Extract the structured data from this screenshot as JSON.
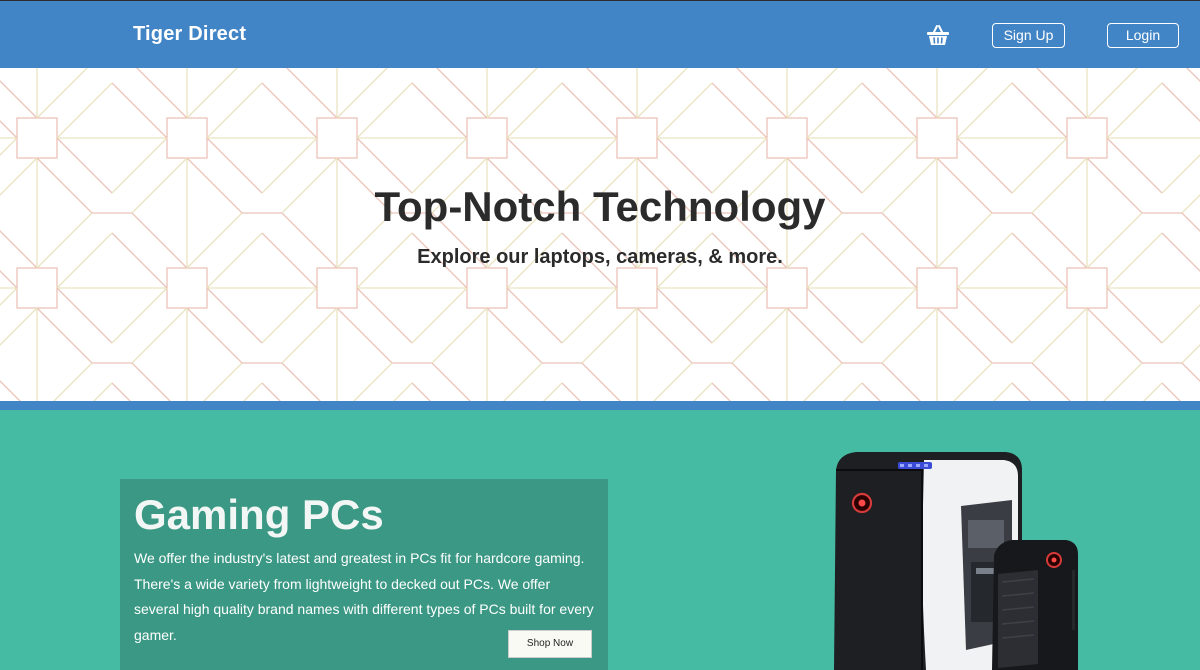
{
  "header": {
    "brand": "Tiger Direct",
    "cart_icon": "shopping-basket-icon",
    "signup_label": "Sign Up",
    "login_label": "Login"
  },
  "hero": {
    "title": "Top-Notch Technology",
    "subtitle": "Explore our laptops, cameras, & more."
  },
  "gaming": {
    "title": "Gaming PCs",
    "description": "We offer the industry's latest and greatest in PCs fit for hardcore gaming. There's a wide variety from lightweight to decked out PCs. We offer several high quality brand names with different types of PCs built for every gamer.",
    "button_label": "Shop Now"
  },
  "colors": {
    "header_bg": "#4285c6",
    "gaming_bg": "#45bba3",
    "card_bg": "#3a9884"
  }
}
